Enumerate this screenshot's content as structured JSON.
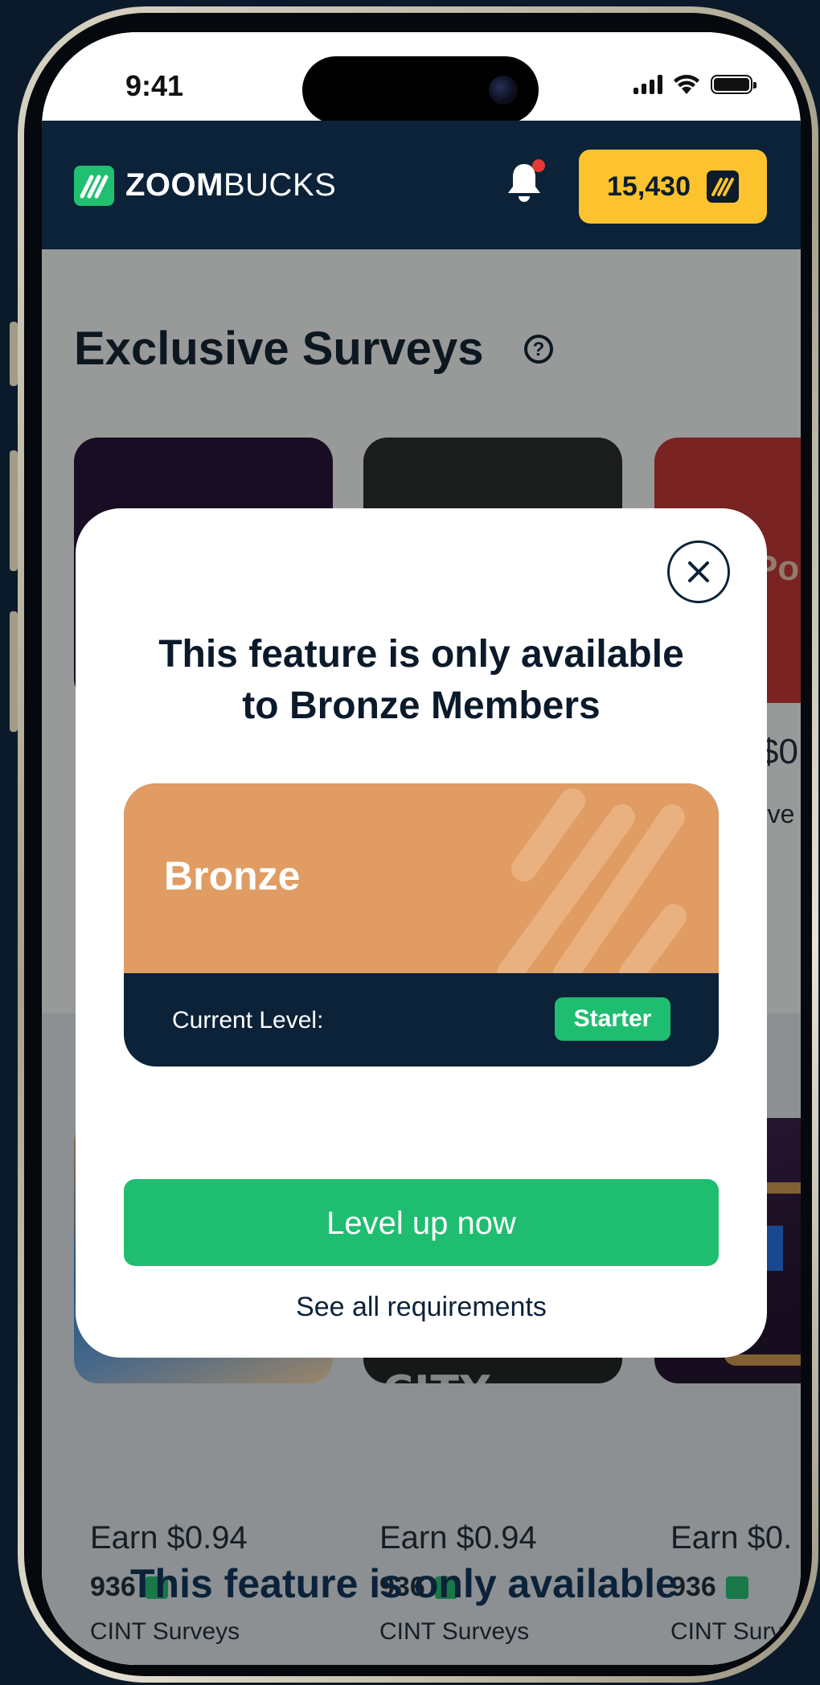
{
  "status_bar": {
    "time": "9:41"
  },
  "header": {
    "logo_bold": "ZOOM",
    "logo_light": "BUCKS",
    "balance": "15,430"
  },
  "page": {
    "title": "Exclusive Surveys",
    "offers": [
      {
        "earn": "Earn $0.94",
        "points": "936",
        "provider": "CINT Surveys"
      },
      {
        "earn": "Earn $0.94",
        "points": "936",
        "provider": "CINT Surveys"
      },
      {
        "earn": "Earn $0.",
        "points": "936",
        "provider": "CINT Surv"
      }
    ],
    "game_title": "MAFIA CITY",
    "partial_card_text": "Po",
    "partial_amount": "$0.",
    "partial_label": "rve",
    "ghost_title": "This feature is only available"
  },
  "modal": {
    "title_line1": "This feature is only available",
    "title_line2": "to Bronze Members",
    "tier_name": "Bronze",
    "current_level_label": "Current Level:",
    "current_level_value": "Starter",
    "cta_label": "Level up now",
    "secondary_link": "See all requirements"
  },
  "colors": {
    "header_bg": "#0b2239",
    "accent_green": "#1fbd70",
    "coin_yellow": "#fcc32e",
    "bronze": "#e09c62"
  }
}
